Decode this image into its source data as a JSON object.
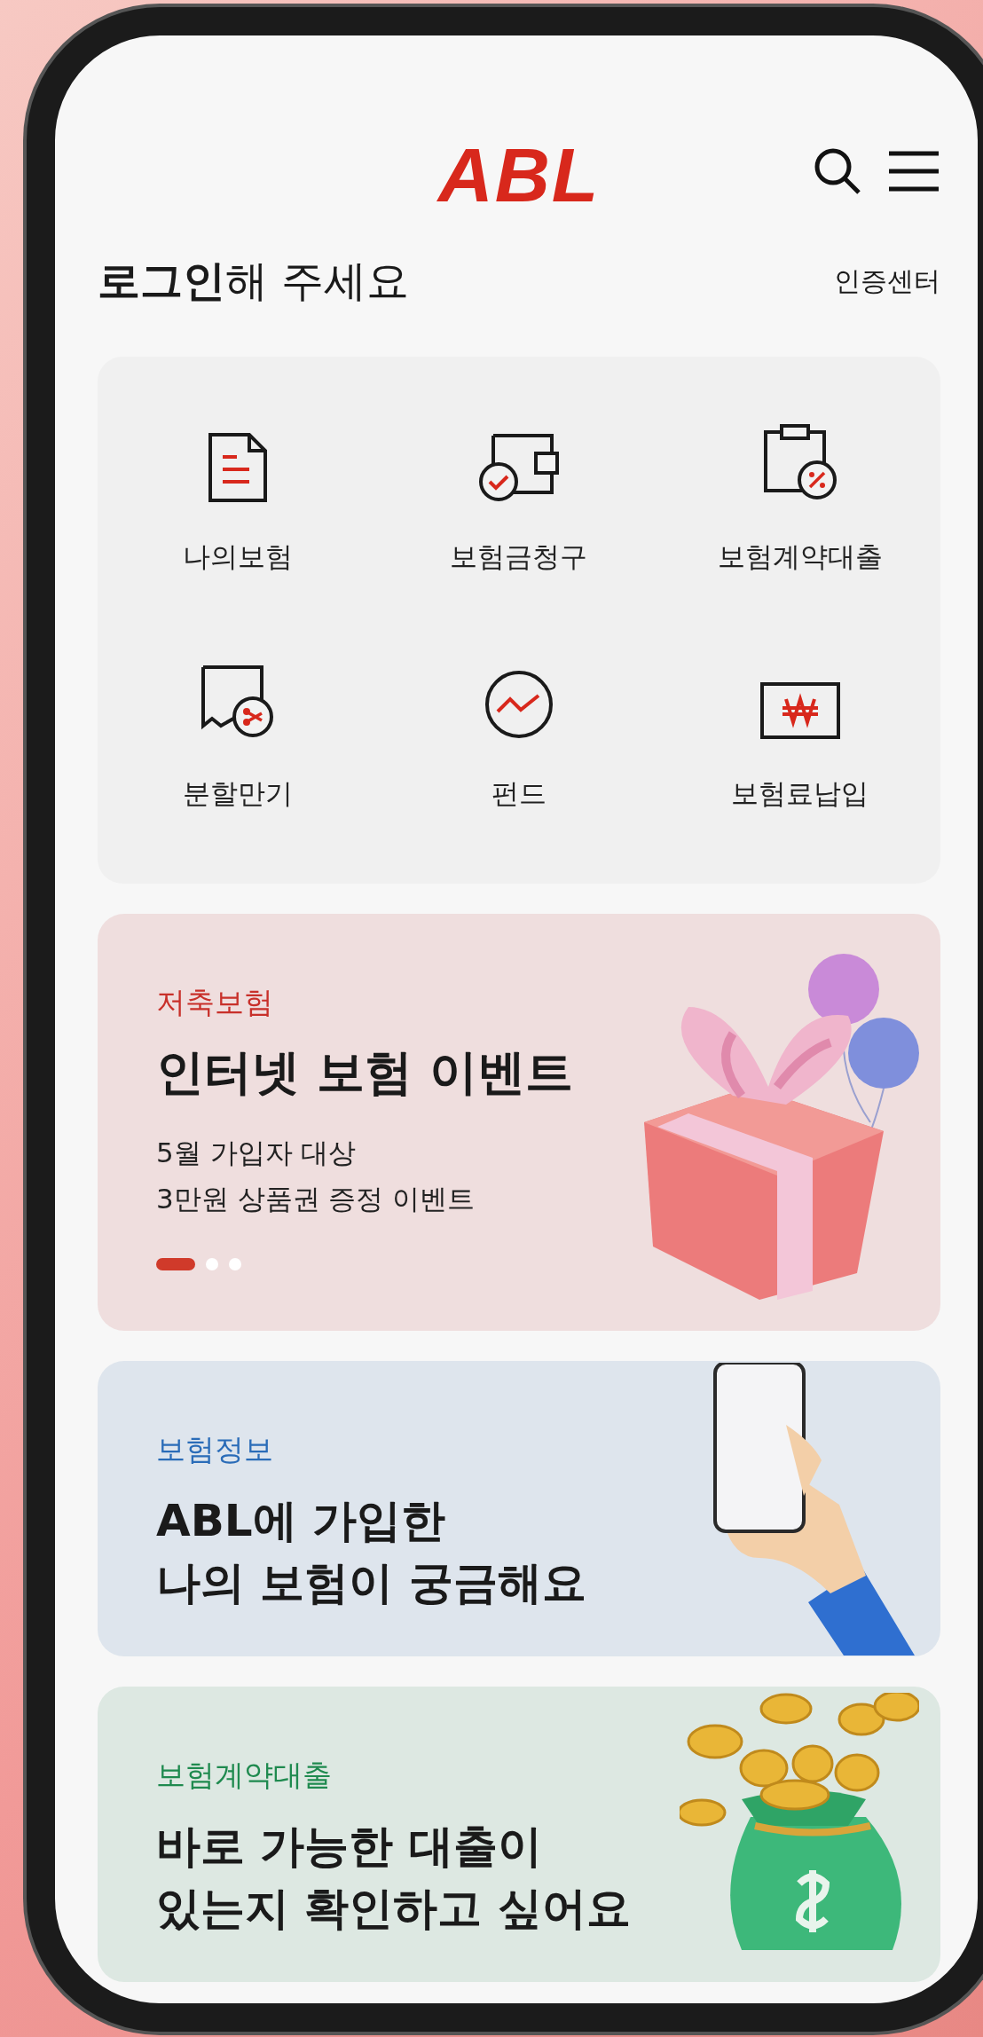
{
  "header": {
    "logo": "ABL"
  },
  "login": {
    "title": "**로그인**해 주세요",
    "link": "인증센터"
  },
  "menu": [
    {
      "label": "나의보험"
    },
    {
      "label": "보험금청구"
    },
    {
      "label": "보험계약대출"
    },
    {
      "label": "분할만기"
    },
    {
      "label": "펀드"
    },
    {
      "label": "보험료납입"
    }
  ],
  "banners": [
    {
      "tag": "저축보험",
      "color": "#c8302a",
      "title": [
        "인터넷 보험 이벤트"
      ],
      "subtitle": [
        "5월 가입자 대상",
        "3만원 상품권 증정 이벤트"
      ],
      "pager": [
        {
          "selected": true
        },
        {
          "selected": false
        },
        {
          "selected": false
        }
      ]
    },
    {
      "tag": "보험정보",
      "color": "#2a6cb8",
      "title": [
        "ABL에 가입한",
        "나의 보험이 궁금해요"
      ]
    },
    {
      "tag": "보험계약대출",
      "color": "#1f8a4f",
      "title": [
        "바로 가능한 대출이",
        "있는지 확인하고 싶어요"
      ]
    }
  ]
}
